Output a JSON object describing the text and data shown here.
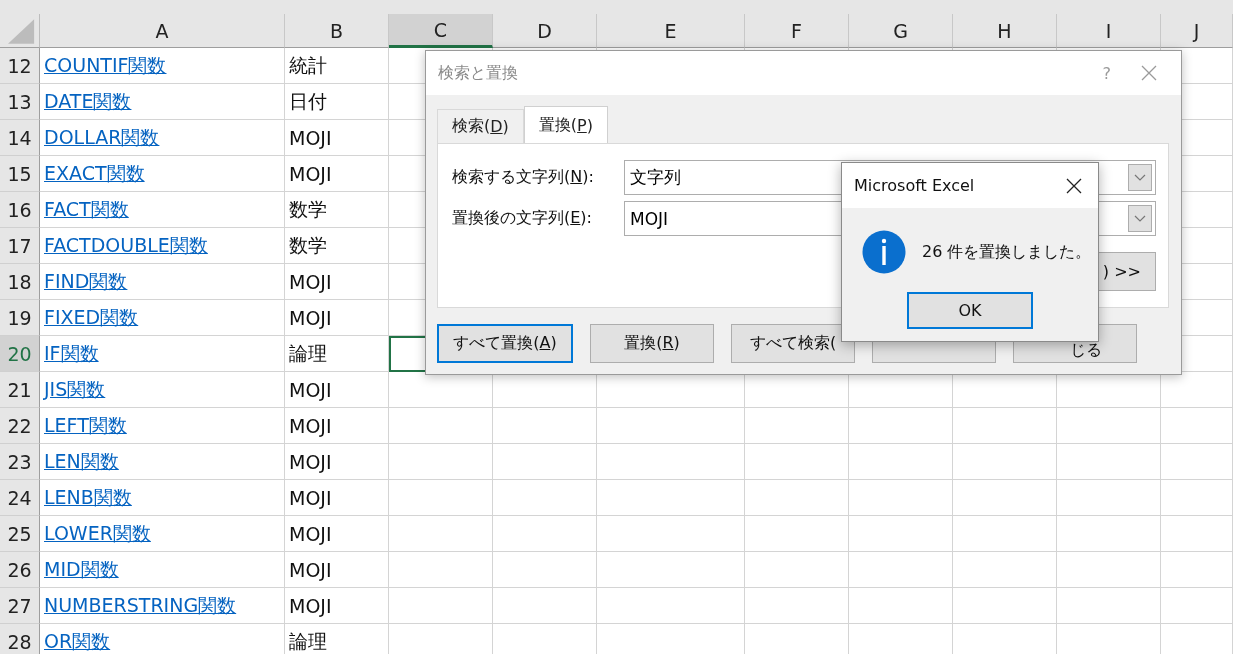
{
  "sheet": {
    "columns": [
      {
        "label": "A",
        "selected": false
      },
      {
        "label": "B",
        "selected": false
      },
      {
        "label": "C",
        "selected": true
      },
      {
        "label": "D",
        "selected": false
      },
      {
        "label": "E",
        "selected": false
      },
      {
        "label": "F",
        "selected": false
      },
      {
        "label": "G",
        "selected": false
      },
      {
        "label": "H",
        "selected": false
      },
      {
        "label": "I",
        "selected": false
      },
      {
        "label": "J",
        "selected": false
      }
    ],
    "rows": [
      {
        "number": "12",
        "a": "COUNTIF関数",
        "b": "統計",
        "selected": false
      },
      {
        "number": "13",
        "a": "DATE関数",
        "b": "日付",
        "selected": false
      },
      {
        "number": "14",
        "a": "DOLLAR関数",
        "b": "MOJI",
        "selected": false
      },
      {
        "number": "15",
        "a": "EXACT関数",
        "b": "MOJI",
        "selected": false
      },
      {
        "number": "16",
        "a": "FACT関数",
        "b": "数学",
        "selected": false
      },
      {
        "number": "17",
        "a": "FACTDOUBLE関数",
        "b": "数学",
        "selected": false
      },
      {
        "number": "18",
        "a": "FIND関数",
        "b": "MOJI",
        "selected": false
      },
      {
        "number": "19",
        "a": "FIXED関数",
        "b": "MOJI",
        "selected": false
      },
      {
        "number": "20",
        "a": "IF関数",
        "b": "論理",
        "selected": true
      },
      {
        "number": "21",
        "a": "JIS関数",
        "b": "MOJI",
        "selected": false
      },
      {
        "number": "22",
        "a": "LEFT関数",
        "b": "MOJI",
        "selected": false
      },
      {
        "number": "23",
        "a": "LEN関数",
        "b": "MOJI",
        "selected": false
      },
      {
        "number": "24",
        "a": "LENB関数",
        "b": "MOJI",
        "selected": false
      },
      {
        "number": "25",
        "a": "LOWER関数",
        "b": "MOJI",
        "selected": false
      },
      {
        "number": "26",
        "a": "MID関数",
        "b": "MOJI",
        "selected": false
      },
      {
        "number": "27",
        "a": "NUMBERSTRING関数",
        "b": "MOJI",
        "selected": false
      },
      {
        "number": "28",
        "a": "OR関数",
        "b": "論理",
        "selected": false
      }
    ]
  },
  "find_replace_dialog": {
    "title": "検索と置換",
    "help": "?",
    "tabs": [
      {
        "text": "検索(",
        "key": "D",
        "tail": ")",
        "selected": false
      },
      {
        "text": "置換(",
        "key": "P",
        "tail": ")",
        "selected": true
      }
    ],
    "fields": [
      {
        "text": "検索する文字列(",
        "key": "N",
        "tail": "):",
        "value": "文字列"
      },
      {
        "text": "置換後の文字列(",
        "key": "E",
        "tail": "):",
        "value": "MOJI"
      }
    ],
    "options_button": {
      "text": ") >>"
    },
    "buttons": [
      {
        "text": "すべて置換(",
        "key": "A",
        "tail": ")",
        "default": true
      },
      {
        "text": "置換(",
        "key": "R",
        "tail": ")",
        "default": false
      },
      {
        "text": "すべて検索(",
        "default": false
      },
      {
        "default": false
      },
      {
        "text": "じる",
        "default": false
      }
    ]
  },
  "message_box": {
    "title": "Microsoft Excel",
    "message": "26 件を置換しました。",
    "ok": "OK"
  }
}
